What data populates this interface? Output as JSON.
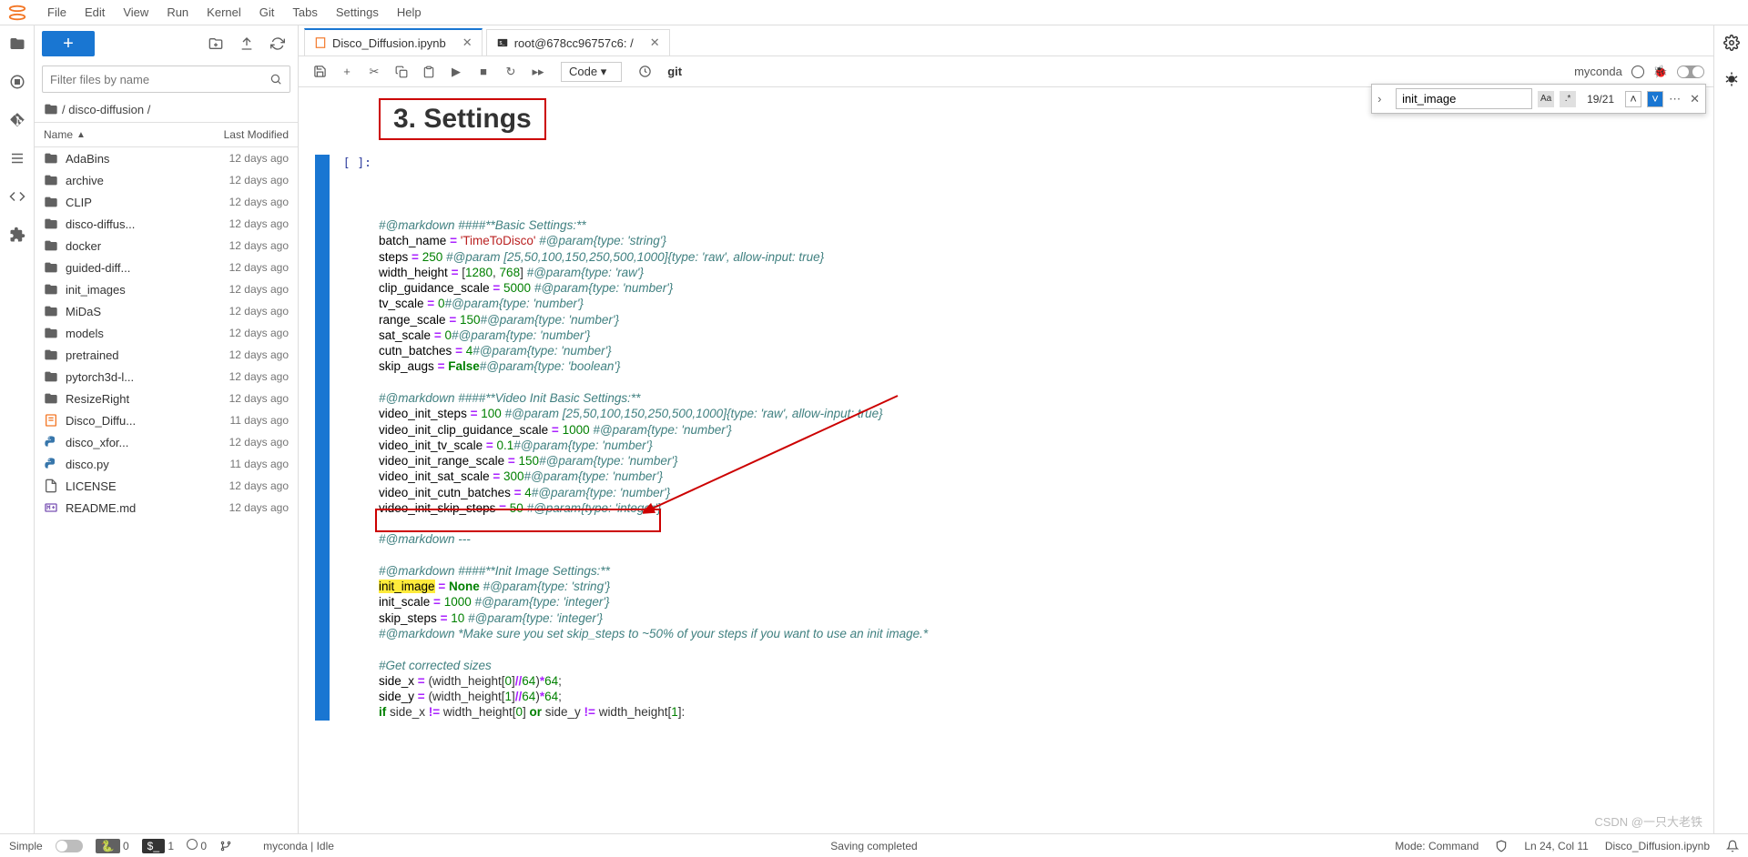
{
  "menu": [
    "File",
    "Edit",
    "View",
    "Run",
    "Kernel",
    "Git",
    "Tabs",
    "Settings",
    "Help"
  ],
  "sidebar": {
    "filter_placeholder": "Filter files by name",
    "breadcrumb_parts": [
      "",
      "disco-diffusion",
      ""
    ],
    "cols": {
      "name": "Name",
      "modified": "Last Modified"
    },
    "files": [
      {
        "name": "AdaBins",
        "type": "folder",
        "mod": "12 days ago"
      },
      {
        "name": "archive",
        "type": "folder",
        "mod": "12 days ago"
      },
      {
        "name": "CLIP",
        "type": "folder",
        "mod": "12 days ago"
      },
      {
        "name": "disco-diffus...",
        "type": "folder",
        "mod": "12 days ago"
      },
      {
        "name": "docker",
        "type": "folder",
        "mod": "12 days ago"
      },
      {
        "name": "guided-diff...",
        "type": "folder",
        "mod": "12 days ago"
      },
      {
        "name": "init_images",
        "type": "folder",
        "mod": "12 days ago"
      },
      {
        "name": "MiDaS",
        "type": "folder",
        "mod": "12 days ago"
      },
      {
        "name": "models",
        "type": "folder",
        "mod": "12 days ago"
      },
      {
        "name": "pretrained",
        "type": "folder",
        "mod": "12 days ago"
      },
      {
        "name": "pytorch3d-l...",
        "type": "folder",
        "mod": "12 days ago"
      },
      {
        "name": "ResizeRight",
        "type": "folder",
        "mod": "12 days ago"
      },
      {
        "name": "Disco_Diffu...",
        "type": "nb",
        "mod": "11 days ago"
      },
      {
        "name": "disco_xfor...",
        "type": "py",
        "mod": "12 days ago"
      },
      {
        "name": "disco.py",
        "type": "py",
        "mod": "11 days ago"
      },
      {
        "name": "LICENSE",
        "type": "file",
        "mod": "12 days ago"
      },
      {
        "name": "README.md",
        "type": "md",
        "mod": "12 days ago"
      }
    ]
  },
  "tabs": [
    {
      "label": "Disco_Diffusion.ipynb",
      "icon": "nb",
      "active": true
    },
    {
      "label": "root@678cc96757c6: /",
      "icon": "term",
      "active": false
    }
  ],
  "nb_toolbar": {
    "celltype": "Code",
    "git": "git",
    "kernel": "myconda"
  },
  "search": {
    "query": "init_image",
    "count": "19/21"
  },
  "heading": "3. Settings",
  "prompt": "[ ]:",
  "status": {
    "left1": "Simple",
    "sp": "0",
    "term": "1",
    "tab": "0",
    "kernel": "myconda | Idle",
    "saving": "Saving completed",
    "mode": "Mode: Command",
    "ln": "Ln 24, Col 11",
    "file": "Disco_Diffusion.ipynb"
  },
  "watermark": "CSDN @一只大老铁",
  "code_lines": [
    [
      [
        "comment",
        "#@markdown ####**Basic Settings:**"
      ]
    ],
    [
      [
        "var",
        "batch_name"
      ],
      [
        "plain",
        " "
      ],
      [
        "op",
        "="
      ],
      [
        "plain",
        " "
      ],
      [
        "str",
        "'TimeToDisco'"
      ],
      [
        "plain",
        " "
      ],
      [
        "comment",
        "#@param{type: 'string'}"
      ]
    ],
    [
      [
        "var",
        "steps"
      ],
      [
        "plain",
        " "
      ],
      [
        "op",
        "="
      ],
      [
        "plain",
        " "
      ],
      [
        "num",
        "250"
      ],
      [
        "plain",
        " "
      ],
      [
        "comment",
        "#@param [25,50,100,150,250,500,1000]{type: 'raw', allow-input: true}"
      ]
    ],
    [
      [
        "var",
        "width_height"
      ],
      [
        "plain",
        " "
      ],
      [
        "op",
        "="
      ],
      [
        "plain",
        " ["
      ],
      [
        "num",
        "1280"
      ],
      [
        "plain",
        ", "
      ],
      [
        "num",
        "768"
      ],
      [
        "plain",
        "] "
      ],
      [
        "comment",
        "#@param{type: 'raw'}"
      ]
    ],
    [
      [
        "var",
        "clip_guidance_scale"
      ],
      [
        "plain",
        " "
      ],
      [
        "op",
        "="
      ],
      [
        "plain",
        " "
      ],
      [
        "num",
        "5000"
      ],
      [
        "plain",
        " "
      ],
      [
        "comment",
        "#@param{type: 'number'}"
      ]
    ],
    [
      [
        "var",
        "tv_scale"
      ],
      [
        "plain",
        " "
      ],
      [
        "op",
        "="
      ],
      [
        "plain",
        " "
      ],
      [
        "num",
        "0"
      ],
      [
        "comment",
        "#@param{type: 'number'}"
      ]
    ],
    [
      [
        "var",
        "range_scale"
      ],
      [
        "plain",
        " "
      ],
      [
        "op",
        "="
      ],
      [
        "plain",
        " "
      ],
      [
        "num",
        "150"
      ],
      [
        "comment",
        "#@param{type: 'number'}"
      ]
    ],
    [
      [
        "var",
        "sat_scale"
      ],
      [
        "plain",
        " "
      ],
      [
        "op",
        "="
      ],
      [
        "plain",
        " "
      ],
      [
        "num",
        "0"
      ],
      [
        "comment",
        "#@param{type: 'number'}"
      ]
    ],
    [
      [
        "var",
        "cutn_batches"
      ],
      [
        "plain",
        " "
      ],
      [
        "op",
        "="
      ],
      [
        "plain",
        " "
      ],
      [
        "num",
        "4"
      ],
      [
        "comment",
        "#@param{type: 'number'}"
      ]
    ],
    [
      [
        "var",
        "skip_augs"
      ],
      [
        "plain",
        " "
      ],
      [
        "op",
        "="
      ],
      [
        "plain",
        " "
      ],
      [
        "bool",
        "False"
      ],
      [
        "comment",
        "#@param{type: 'boolean'}"
      ]
    ],
    [
      [
        "plain",
        ""
      ]
    ],
    [
      [
        "comment",
        "#@markdown ####**Video Init Basic Settings:**"
      ]
    ],
    [
      [
        "var",
        "video_init_steps"
      ],
      [
        "plain",
        " "
      ],
      [
        "op",
        "="
      ],
      [
        "plain",
        " "
      ],
      [
        "num",
        "100"
      ],
      [
        "plain",
        " "
      ],
      [
        "comment",
        "#@param [25,50,100,150,250,500,1000]{type: 'raw', allow-input: true}"
      ]
    ],
    [
      [
        "var",
        "video_init_clip_guidance_scale"
      ],
      [
        "plain",
        " "
      ],
      [
        "op",
        "="
      ],
      [
        "plain",
        " "
      ],
      [
        "num",
        "1000"
      ],
      [
        "plain",
        " "
      ],
      [
        "comment",
        "#@param{type: 'number'}"
      ]
    ],
    [
      [
        "var",
        "video_init_tv_scale"
      ],
      [
        "plain",
        " "
      ],
      [
        "op",
        "="
      ],
      [
        "plain",
        " "
      ],
      [
        "num",
        "0.1"
      ],
      [
        "comment",
        "#@param{type: 'number'}"
      ]
    ],
    [
      [
        "var",
        "video_init_range_scale"
      ],
      [
        "plain",
        " "
      ],
      [
        "op",
        "="
      ],
      [
        "plain",
        " "
      ],
      [
        "num",
        "150"
      ],
      [
        "comment",
        "#@param{type: 'number'}"
      ]
    ],
    [
      [
        "var",
        "video_init_sat_scale"
      ],
      [
        "plain",
        " "
      ],
      [
        "op",
        "="
      ],
      [
        "plain",
        " "
      ],
      [
        "num",
        "300"
      ],
      [
        "comment",
        "#@param{type: 'number'}"
      ]
    ],
    [
      [
        "var",
        "video_init_cutn_batches"
      ],
      [
        "plain",
        " "
      ],
      [
        "op",
        "="
      ],
      [
        "plain",
        " "
      ],
      [
        "num",
        "4"
      ],
      [
        "comment",
        "#@param{type: 'number'}"
      ]
    ],
    [
      [
        "var",
        "video_init_skip_steps"
      ],
      [
        "plain",
        " "
      ],
      [
        "op",
        "="
      ],
      [
        "plain",
        " "
      ],
      [
        "num",
        "50"
      ],
      [
        "plain",
        " "
      ],
      [
        "comment",
        "#@param{type: 'integer'}"
      ]
    ],
    [
      [
        "plain",
        ""
      ]
    ],
    [
      [
        "comment",
        "#@markdown ---"
      ]
    ],
    [
      [
        "plain",
        ""
      ]
    ],
    [
      [
        "comment",
        "#@markdown ####**Init Image Settings:**"
      ]
    ],
    [
      [
        "hlvar",
        "init_image"
      ],
      [
        "plain",
        " "
      ],
      [
        "op",
        "="
      ],
      [
        "plain",
        " "
      ],
      [
        "bool",
        "None"
      ],
      [
        "plain",
        " "
      ],
      [
        "comment",
        "#@param{type: 'string'}"
      ]
    ],
    [
      [
        "var",
        "init_scale"
      ],
      [
        "plain",
        " "
      ],
      [
        "op",
        "="
      ],
      [
        "plain",
        " "
      ],
      [
        "num",
        "1000"
      ],
      [
        "plain",
        " "
      ],
      [
        "comment",
        "#@param{type: 'integer'}"
      ]
    ],
    [
      [
        "var",
        "skip_steps"
      ],
      [
        "plain",
        " "
      ],
      [
        "op",
        "="
      ],
      [
        "plain",
        " "
      ],
      [
        "num",
        "10"
      ],
      [
        "plain",
        " "
      ],
      [
        "comment",
        "#@param{type: 'integer'}"
      ]
    ],
    [
      [
        "comment",
        "#@markdown *Make sure you set skip_steps to ~50% of your steps if you want to use an init image.*"
      ]
    ],
    [
      [
        "plain",
        ""
      ]
    ],
    [
      [
        "comment",
        "#Get corrected sizes"
      ]
    ],
    [
      [
        "var",
        "side_x"
      ],
      [
        "plain",
        " "
      ],
      [
        "op",
        "="
      ],
      [
        "plain",
        " (width_height["
      ],
      [
        "num",
        "0"
      ],
      [
        "plain",
        "]"
      ],
      [
        "op",
        "//"
      ],
      [
        "num",
        "64"
      ],
      [
        "plain",
        ")"
      ],
      [
        "op",
        "*"
      ],
      [
        "num",
        "64"
      ],
      [
        "plain",
        ";"
      ]
    ],
    [
      [
        "var",
        "side_y"
      ],
      [
        "plain",
        " "
      ],
      [
        "op",
        "="
      ],
      [
        "plain",
        " (width_height["
      ],
      [
        "num",
        "1"
      ],
      [
        "plain",
        "]"
      ],
      [
        "op",
        "//"
      ],
      [
        "num",
        "64"
      ],
      [
        "plain",
        ")"
      ],
      [
        "op",
        "*"
      ],
      [
        "num",
        "64"
      ],
      [
        "plain",
        ";"
      ]
    ],
    [
      [
        "kw",
        "if"
      ],
      [
        "plain",
        " side_x "
      ],
      [
        "op",
        "!="
      ],
      [
        "plain",
        " width_height["
      ],
      [
        "num",
        "0"
      ],
      [
        "plain",
        "] "
      ],
      [
        "kw",
        "or"
      ],
      [
        "plain",
        " side_y "
      ],
      [
        "op",
        "!="
      ],
      [
        "plain",
        " width_height["
      ],
      [
        "num",
        "1"
      ],
      [
        "plain",
        "]:"
      ]
    ]
  ]
}
